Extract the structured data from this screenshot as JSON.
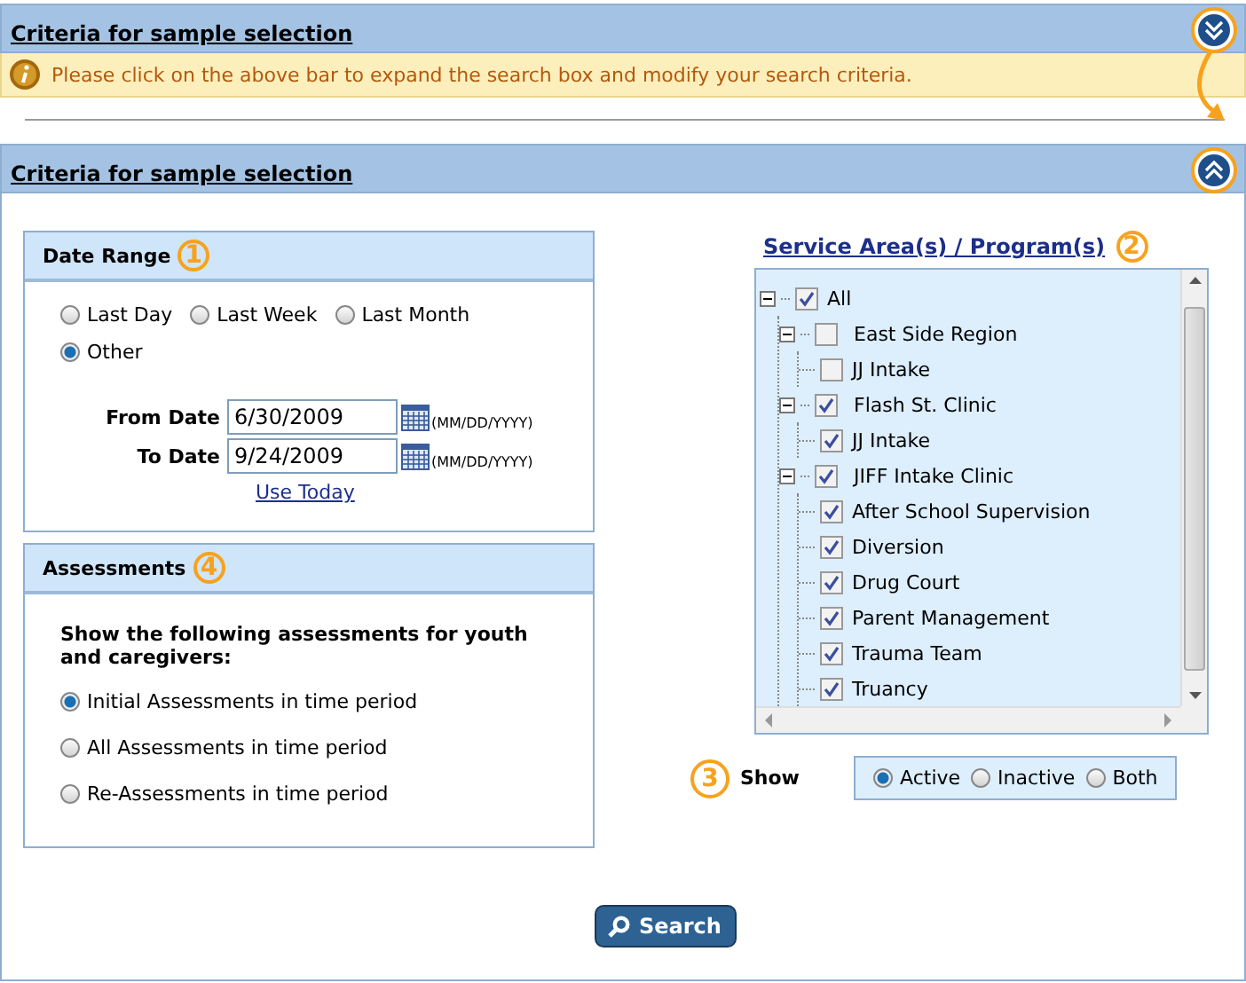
{
  "collapsed_bar": {
    "title": "Criteria for sample selection",
    "callout": "Please click on the above bar to expand the search box and modify your search criteria."
  },
  "expanded_bar": {
    "title": "Criteria for sample selection"
  },
  "date_range": {
    "title": "Date Range",
    "badge": "1",
    "options": [
      {
        "label": "Last Day",
        "selected": false
      },
      {
        "label": "Last Week",
        "selected": false
      },
      {
        "label": "Last Month",
        "selected": false
      },
      {
        "label": "Other",
        "selected": true
      }
    ],
    "from_label": "From Date",
    "from_value": "6/30/2009",
    "to_label": "To Date",
    "to_value": "9/24/2009",
    "from_hint": "(MM/DD/YYYY)",
    "to_hint": "(MM/DD/YYYY)",
    "use_today": "Use Today"
  },
  "assessments": {
    "title": "Assessments",
    "badge": "4",
    "prompt": "Show the following assessments for youth and caregivers:",
    "options": [
      {
        "label": "Initial Assessments in time period",
        "selected": true
      },
      {
        "label": "All Assessments in time period",
        "selected": false
      },
      {
        "label": "Re-Assessments in time period",
        "selected": false
      }
    ]
  },
  "service_areas": {
    "title": "Service Area(s) / Program(s)",
    "badge": "2",
    "tree": [
      {
        "label": "All",
        "checked": true,
        "expanded": true,
        "children": [
          {
            "label": "East Side Region",
            "checked": false,
            "expanded": true,
            "children": [
              {
                "label": "JJ Intake",
                "checked": false
              }
            ]
          },
          {
            "label": "Flash St. Clinic",
            "checked": true,
            "expanded": true,
            "children": [
              {
                "label": "JJ Intake",
                "checked": true
              }
            ]
          },
          {
            "label": "JIFF Intake Clinic",
            "checked": true,
            "expanded": true,
            "children": [
              {
                "label": "After School Supervision",
                "checked": true
              },
              {
                "label": "Diversion",
                "checked": true
              },
              {
                "label": "Drug Court",
                "checked": true
              },
              {
                "label": "Parent Management",
                "checked": true
              },
              {
                "label": "Trauma Team",
                "checked": true
              },
              {
                "label": "Truancy",
                "checked": true
              }
            ]
          }
        ]
      }
    ]
  },
  "show": {
    "badge": "3",
    "label": "Show",
    "options": [
      {
        "label": "Active",
        "selected": true
      },
      {
        "label": "Inactive",
        "selected": false
      },
      {
        "label": "Both",
        "selected": false
      }
    ]
  },
  "search_button": "Search"
}
